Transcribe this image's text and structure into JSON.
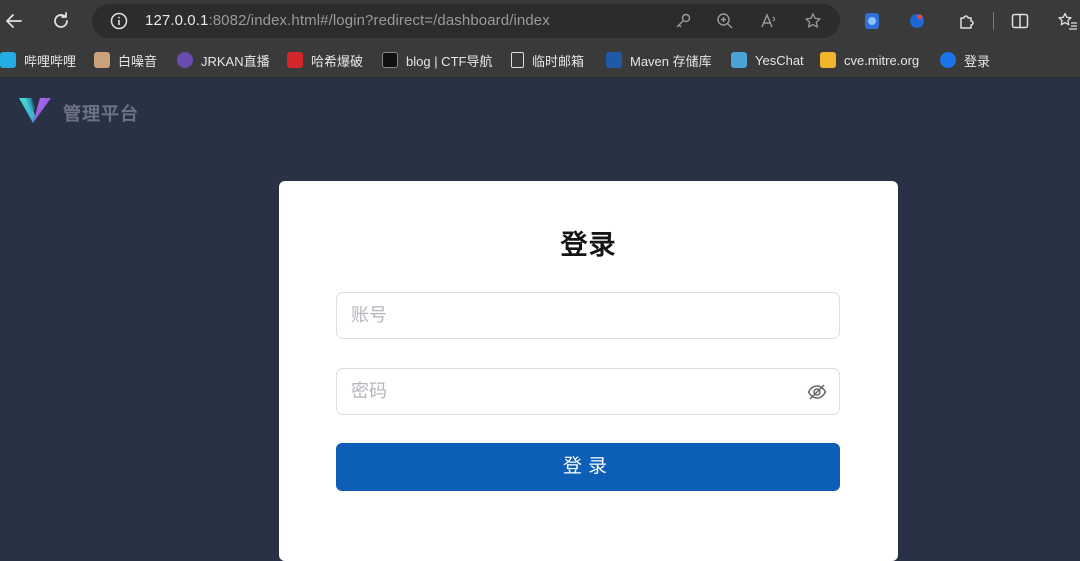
{
  "browser": {
    "url_host": "127.0.0.1",
    "url_rest": ":8082/index.html#/login?redirect=/dashboard/index",
    "bookmarks": [
      {
        "label": "哔哩哔哩",
        "icon": "bilibili-icon",
        "color": "#23ade5"
      },
      {
        "label": "白噪音",
        "icon": "cat-icon",
        "color": "#c9a27a"
      },
      {
        "label": "JRKAN直播",
        "icon": "globe-icon",
        "color": "#6a4bb0"
      },
      {
        "label": "哈希爆破",
        "icon": "d-badge-icon",
        "color": "#d6262a"
      },
      {
        "label": "blog | CTF导航",
        "icon": "wolf-icon",
        "color": "#111111"
      },
      {
        "label": "临时邮箱",
        "icon": "page-icon",
        "color": "#dddddd"
      },
      {
        "label": "Maven 存储库",
        "icon": "maven-icon",
        "color": "#1f5aa8"
      },
      {
        "label": "YesChat",
        "icon": "chart-icon",
        "color": "#4aa3d6"
      },
      {
        "label": "cve.mitre.org",
        "icon": "folder-icon",
        "color": "#f2b429"
      },
      {
        "label": "登录",
        "icon": "gs-icon",
        "color": "#1a73e8"
      }
    ]
  },
  "app": {
    "brand": "管理平台",
    "login": {
      "title": "登录",
      "username_placeholder": "账号",
      "password_placeholder": "密码",
      "submit_label": "登录"
    },
    "colors": {
      "background": "#293145",
      "primary": "#0c5eb7"
    }
  }
}
